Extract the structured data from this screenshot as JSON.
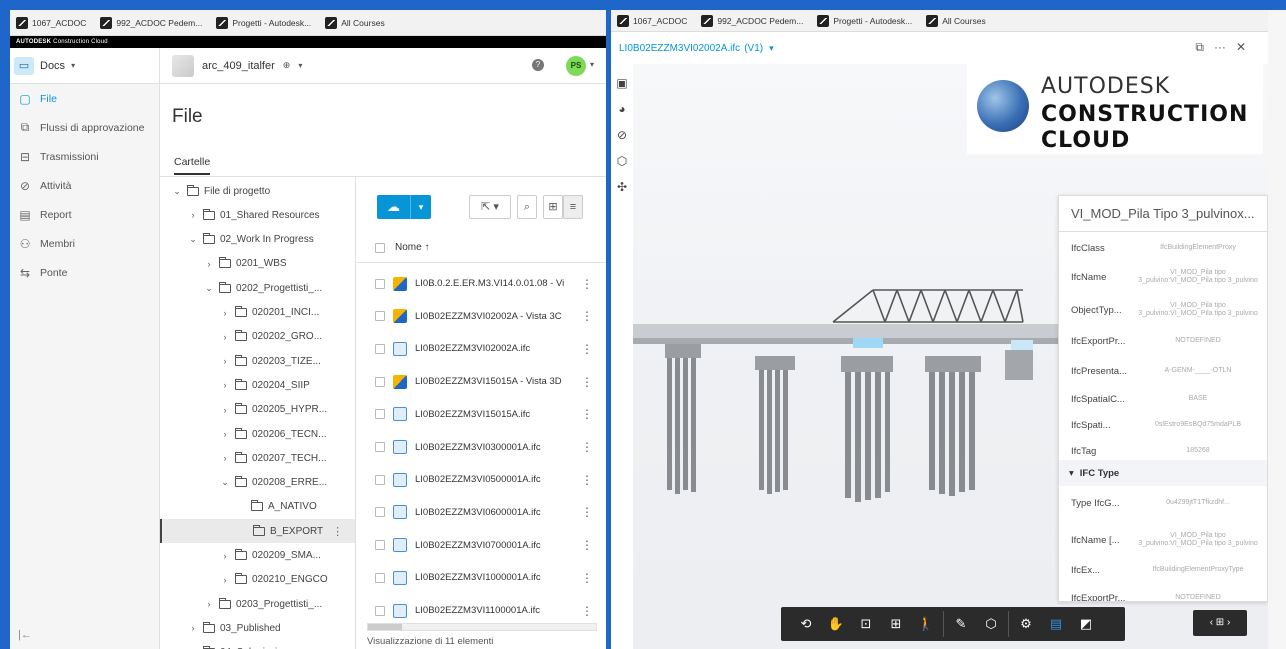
{
  "bookmarks": [
    "1067_ACDOC",
    "992_ACDOC Pedem...",
    "Progetti - Autodesk...",
    "All Courses"
  ],
  "brand": {
    "bold": "AUTODESK",
    "light": "Construction Cloud"
  },
  "topnav": {
    "module": "Docs",
    "project": "arc_409_italfer",
    "avatar": "PS"
  },
  "sidebar": {
    "items": [
      {
        "label": "File",
        "icon": "file-icon"
      },
      {
        "label": "Flussi di approvazione",
        "icon": "approval-icon"
      },
      {
        "label": "Trasmissioni",
        "icon": "transmittal-icon"
      },
      {
        "label": "Attività",
        "icon": "activity-icon"
      },
      {
        "label": "Report",
        "icon": "report-icon"
      },
      {
        "label": "Membri",
        "icon": "members-icon"
      },
      {
        "label": "Ponte",
        "icon": "bridge-icon"
      }
    ]
  },
  "main": {
    "title": "File",
    "tab": "Cartelle",
    "column_name": "Nome ↑",
    "count": "Visualizzazione di 11 elementi"
  },
  "tree": [
    {
      "label": "File di progetto",
      "level": 0,
      "chev": "v"
    },
    {
      "label": "01_Shared Resources",
      "level": 1,
      "chev": ">"
    },
    {
      "label": "02_Work In Progress",
      "level": 1,
      "chev": "v"
    },
    {
      "label": "0201_WBS",
      "level": 2,
      "chev": ">"
    },
    {
      "label": "0202_Progettisti_...",
      "level": 2,
      "chev": "v"
    },
    {
      "label": "020201_INCI...",
      "level": 3,
      "chev": ">"
    },
    {
      "label": "020202_GRO...",
      "level": 3,
      "chev": ">"
    },
    {
      "label": "020203_TIZE...",
      "level": 3,
      "chev": ">"
    },
    {
      "label": "020204_SIIP",
      "level": 3,
      "chev": ">"
    },
    {
      "label": "020205_HYPR...",
      "level": 3,
      "chev": ">"
    },
    {
      "label": "020206_TECN...",
      "level": 3,
      "chev": ">"
    },
    {
      "label": "020207_TECH...",
      "level": 3,
      "chev": ">"
    },
    {
      "label": "020208_ERRE...",
      "level": 3,
      "chev": "v"
    },
    {
      "label": "A_NATIVO",
      "level": 4,
      "chev": ""
    },
    {
      "label": "B_EXPORT",
      "level": 4,
      "chev": ""
    },
    {
      "label": "020209_SMA...",
      "level": 3,
      "chev": ">"
    },
    {
      "label": "020210_ENGCO",
      "level": 3,
      "chev": ">"
    },
    {
      "label": "0203_Progettisti_...",
      "level": 2,
      "chev": ">"
    },
    {
      "label": "03_Published",
      "level": 1,
      "chev": ">"
    },
    {
      "label": "04_Submission",
      "level": 1,
      "chev": ""
    }
  ],
  "files": [
    {
      "name": "LI0B.0.2.E.ER.M3.VI14.0.01.08 - Vi",
      "type": "vista"
    },
    {
      "name": "LI0B02EZZM3VI02002A - Vista 3C",
      "type": "vista"
    },
    {
      "name": "LI0B02EZZM3VI02002A.ifc",
      "type": "ifc"
    },
    {
      "name": "LI0B02EZZM3VI15015A - Vista 3D",
      "type": "vista"
    },
    {
      "name": "LI0B02EZZM3VI15015A.ifc",
      "type": "ifc"
    },
    {
      "name": "LI0B02EZZM3VI0300001A.ifc",
      "type": "ifc"
    },
    {
      "name": "LI0B02EZZM3VI0500001A.ifc",
      "type": "ifc"
    },
    {
      "name": "LI0B02EZZM3VI0600001A.ifc",
      "type": "ifc"
    },
    {
      "name": "LI0B02EZZM3VI0700001A.ifc",
      "type": "ifc"
    },
    {
      "name": "LI0B02EZZM3VI1000001A.ifc",
      "type": "ifc"
    },
    {
      "name": "LI0B02EZZM3VI1100001A.ifc",
      "type": "ifc"
    }
  ],
  "viewer": {
    "filename": "LI0B02EZZM3VI02002A.ifc",
    "version": "(V1)"
  },
  "logo": {
    "line1": "AUTODESK",
    "line2": "CONSTRUCTION",
    "line3": "CLOUD"
  },
  "props": {
    "title": "VI_MOD_Pila Tipo 3_pulvinox...",
    "rows": [
      {
        "key": "IfcClass",
        "val": "IfcBuildingElementProxy"
      },
      {
        "key": "IfcName",
        "val": "VI_MOD_Pila tipo 3_pulvino:VI_MOD_Pila tipo 3_pulvino"
      },
      {
        "key": "ObjectTyp...",
        "val": "VI_MOD_Pila tipo 3_pulvino:VI_MOD_Pila tipo 3_pulvino"
      },
      {
        "key": "IfcExportPr...",
        "val": "NOTDEFINED"
      },
      {
        "key": "IfcPresenta...",
        "val": "A-GENM-____-OTLN"
      },
      {
        "key": "IfcSpatialC...",
        "val": "BASE"
      },
      {
        "key": "IfcSpati...",
        "val": "0slEstro9EsBQd75mdaPLB"
      },
      {
        "key": "IfcTag",
        "val": "185268"
      }
    ],
    "section": "IFC Type",
    "type_rows": [
      {
        "key": "Type IfcG...",
        "val": "0u4299jtT1Tfkzdhf... "
      },
      {
        "key": "IfcName [...",
        "val": "VI_MOD_Pila tipo 3_pulvino:VI_MOD_Pila tipo 3_pulvino"
      },
      {
        "key": "IfcEx...",
        "val": "IfcBuildingElementProxyType"
      },
      {
        "key": "IfcExportPr...",
        "val": "NOTDEFINED"
      }
    ]
  },
  "colors": {
    "accent": "#0696d7",
    "dark_toolbar": "#2b2b2b",
    "tool_blue": "#2e8fe0"
  }
}
